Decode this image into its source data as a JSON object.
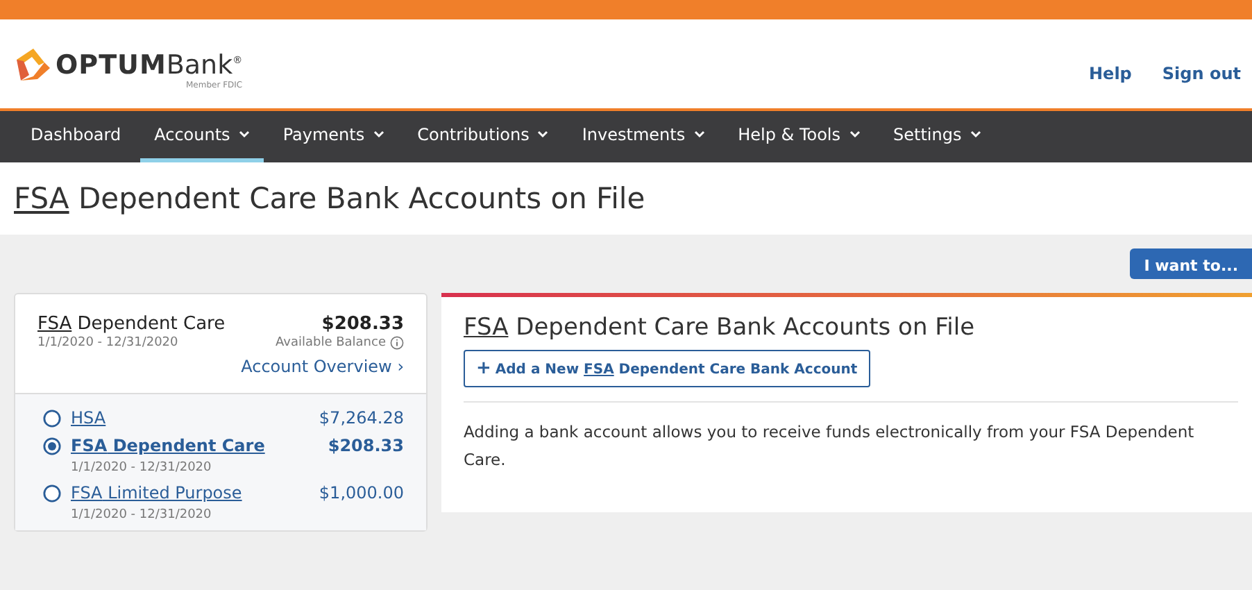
{
  "header": {
    "logo": {
      "brand": "OPTUM",
      "product": "Bank",
      "mark": "®",
      "tagline": "Member FDIC"
    },
    "links": [
      "Help",
      "Sign out"
    ]
  },
  "nav": [
    {
      "label": "Dashboard",
      "dropdown": false,
      "selected": false
    },
    {
      "label": "Accounts",
      "dropdown": true,
      "selected": true
    },
    {
      "label": "Payments",
      "dropdown": true,
      "selected": false
    },
    {
      "label": "Contributions",
      "dropdown": true,
      "selected": false
    },
    {
      "label": "Investments",
      "dropdown": true,
      "selected": false
    },
    {
      "label": "Help & Tools",
      "dropdown": true,
      "selected": false
    },
    {
      "label": "Settings",
      "dropdown": true,
      "selected": false
    }
  ],
  "page_title": {
    "abbr": "FSA",
    "text": " Dependent Care Bank Accounts on File"
  },
  "action_button": "I want to...",
  "account_summary": {
    "abbr": "FSA",
    "name": " Dependent Care",
    "dates": "1/1/2020 - 12/31/2020",
    "amount": "$208.33",
    "balance_label": "Available Balance",
    "link": "Account Overview",
    "link_arrow": "›"
  },
  "accounts": [
    {
      "abbr": "HSA",
      "amount": "$7,264.28",
      "selected": false
    },
    {
      "abbr": "FSA",
      "name": " Dependent Care",
      "dates": "1/1/2020 - 12/31/2020",
      "amount": "$208.33",
      "selected": true
    },
    {
      "abbr": "FSA",
      "name": " Limited Purpose",
      "dates": "1/1/2020 - 12/31/2020",
      "amount": "$1,000.00",
      "selected": false
    }
  ],
  "panel": {
    "title": {
      "abbr": "FSA",
      "text": " Dependent Care Bank Accounts on File"
    },
    "add_button": {
      "icon": "+",
      "before": "Add a New ",
      "abbr": "FSA",
      "after": " Dependent Care Bank Account"
    },
    "description": "Adding a bank account allows you to receive funds electronically from your FSA Dependent Care."
  }
}
